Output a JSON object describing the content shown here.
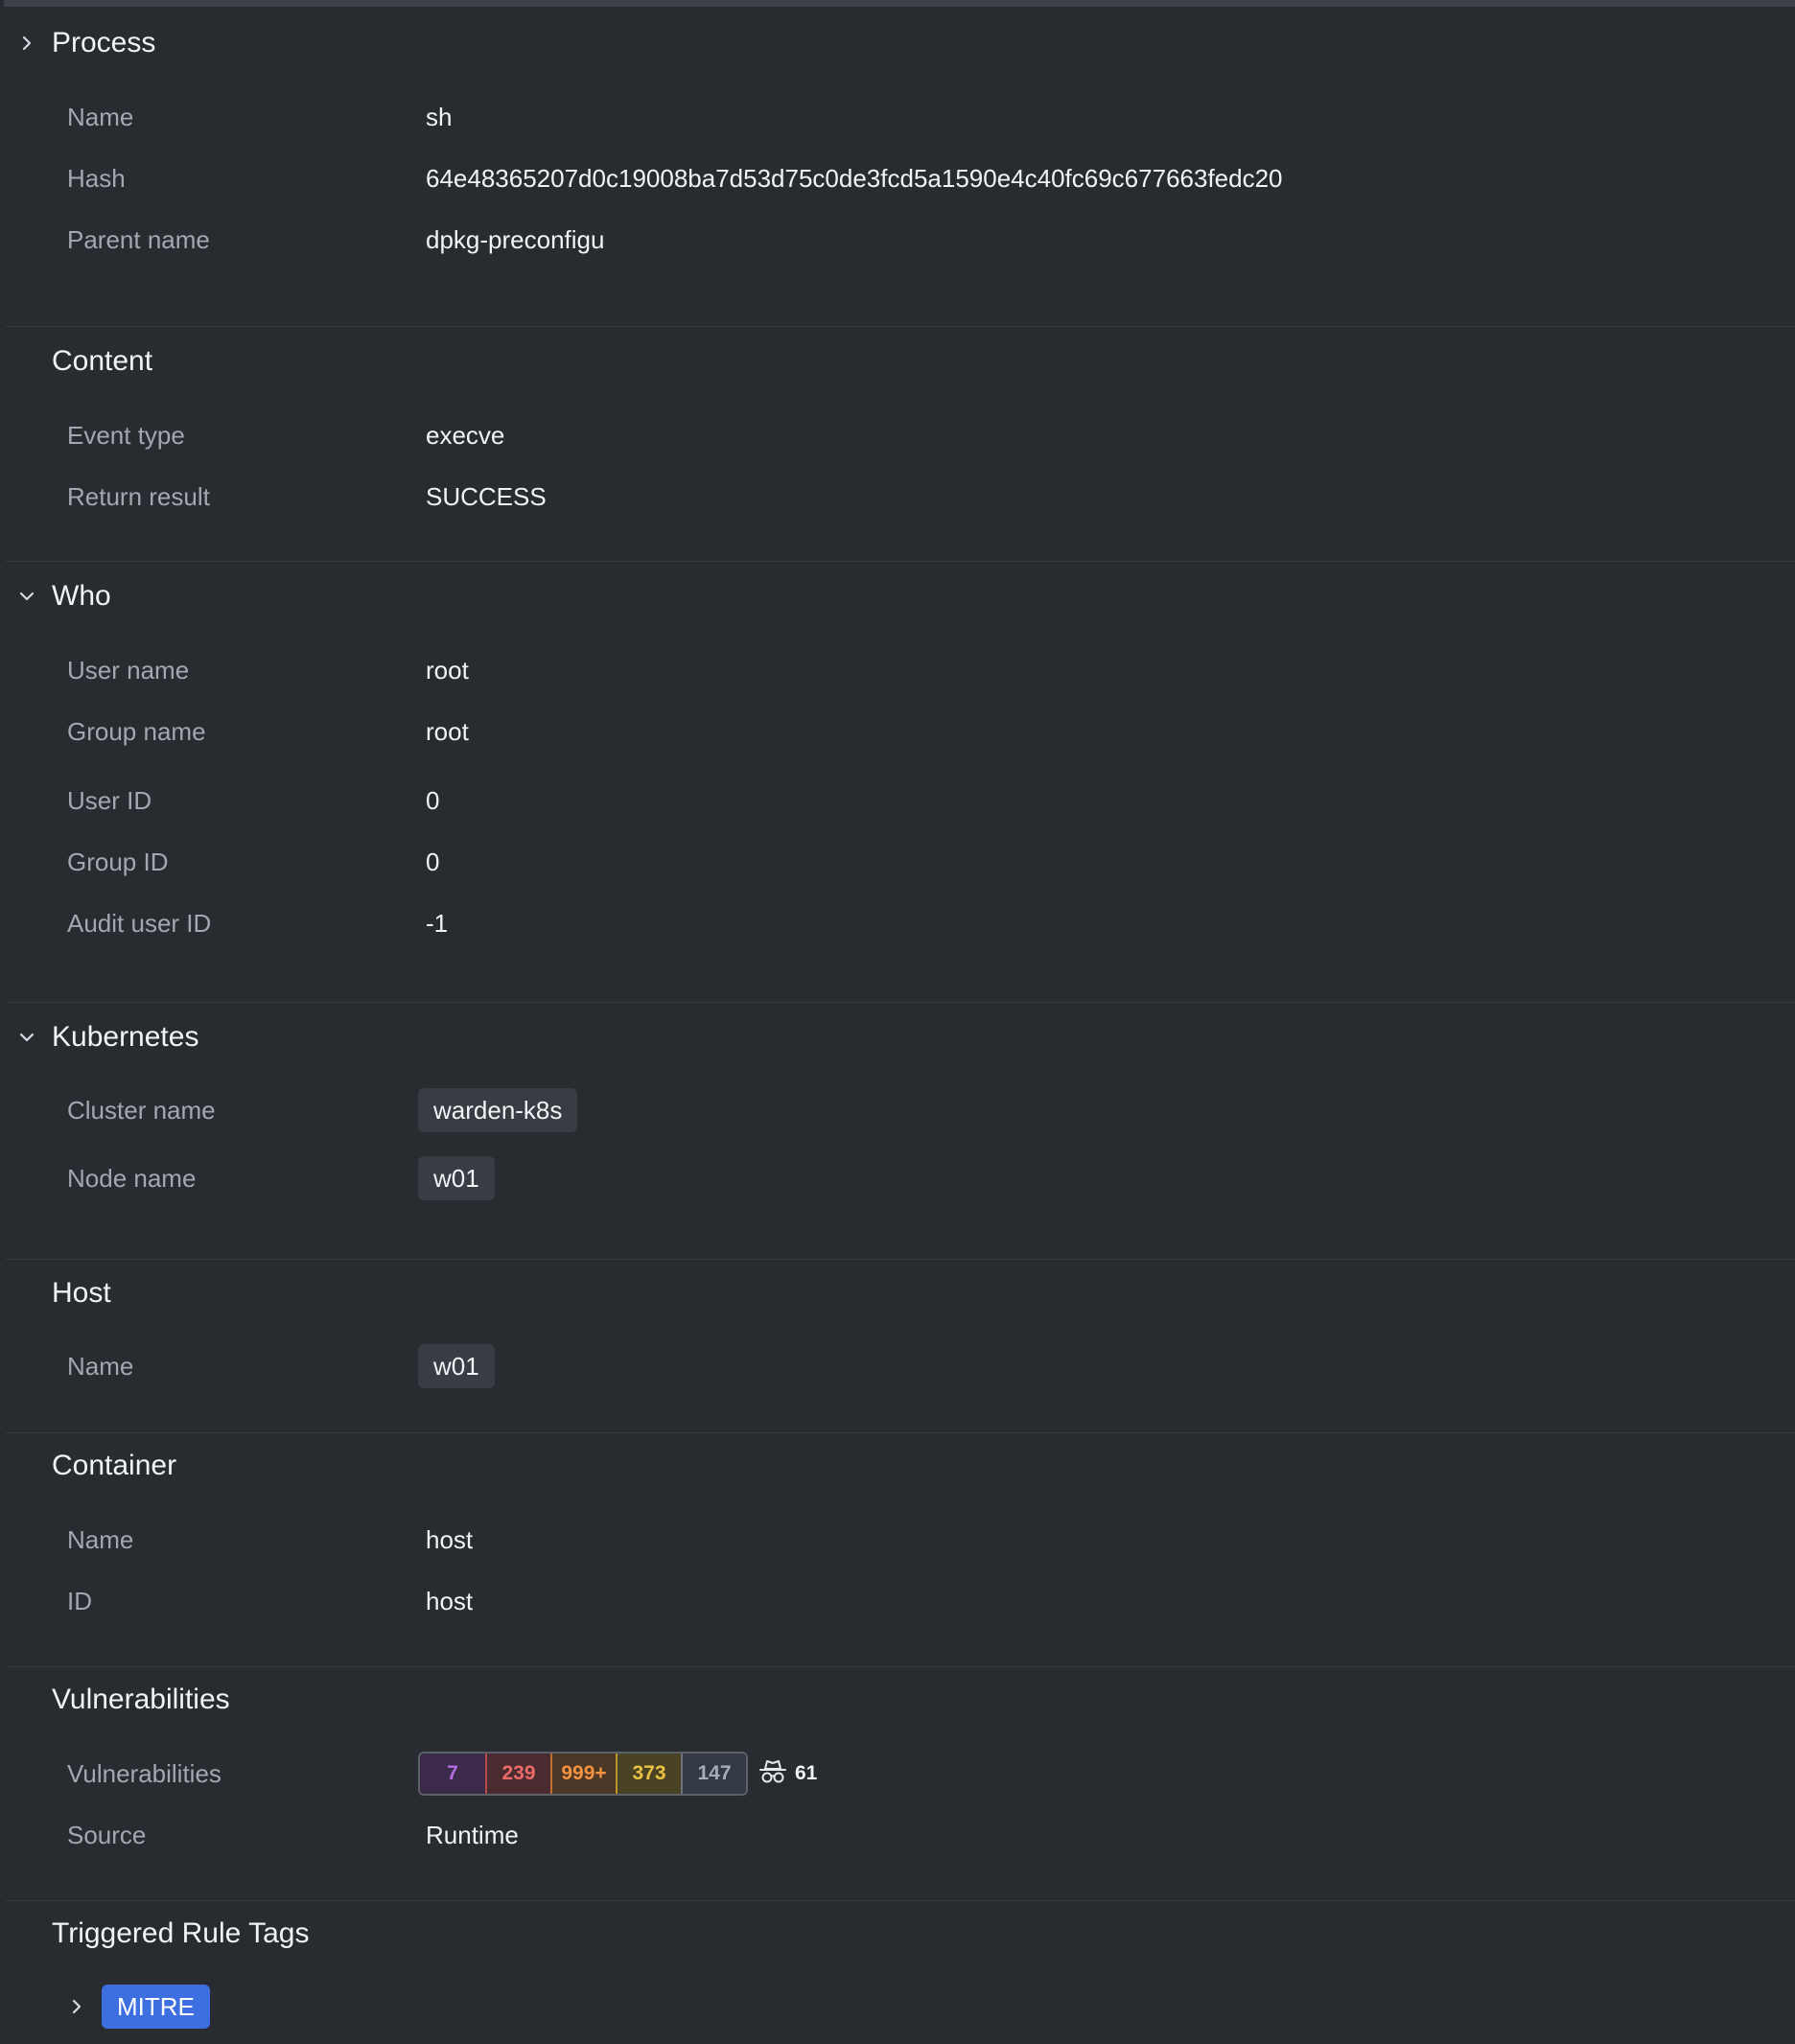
{
  "colors": {
    "background": "#282b30",
    "chip_background": "#383c43",
    "tag_accent": "#3e6fe0",
    "critical": "#b56be0",
    "high": "#ec6a67",
    "medium": "#f3933f",
    "low": "#e9c243",
    "negligible": "#a5adba"
  },
  "process": {
    "title": "Process",
    "icon": "chevron-right-icon",
    "name_label": "Name",
    "name_value": "sh",
    "hash_label": "Hash",
    "hash_value": "64e48365207d0c19008ba7d53d75c0de3fcd5a1590e4c40fc69c677663fedc20",
    "parent_label": "Parent name",
    "parent_value": "dpkg-preconfigu"
  },
  "content": {
    "title": "Content",
    "event_type_label": "Event type",
    "event_type_value": "execve",
    "return_label": "Return result",
    "return_value": "SUCCESS"
  },
  "who": {
    "title": "Who",
    "icon": "chevron-down-icon",
    "user_name_label": "User name",
    "user_name_value": "root",
    "group_name_label": "Group name",
    "group_name_value": "root",
    "user_id_label": "User ID",
    "user_id_value": "0",
    "group_id_label": "Group ID",
    "group_id_value": "0",
    "audit_label": "Audit user ID",
    "audit_value": "-1"
  },
  "kubernetes": {
    "title": "Kubernetes",
    "icon": "chevron-down-icon",
    "cluster_label": "Cluster name",
    "cluster_value": "warden-k8s",
    "node_label": "Node name",
    "node_value": "w01"
  },
  "host": {
    "title": "Host",
    "name_label": "Name",
    "name_value": "w01"
  },
  "container": {
    "title": "Container",
    "name_label": "Name",
    "name_value": "host",
    "id_label": "ID",
    "id_value": "host"
  },
  "vulnerabilities": {
    "title": "Vulnerabilities",
    "label": "Vulnerabilities",
    "critical": "7",
    "high": "239",
    "medium": "999+",
    "low": "373",
    "negligible": "147",
    "exploit_icon": "spy-icon",
    "exploit_count": "61",
    "source_label": "Source",
    "source_value": "Runtime"
  },
  "rule_tags": {
    "title": "Triggered Rule Tags",
    "icon": "chevron-right-icon",
    "tag": "MITRE"
  }
}
